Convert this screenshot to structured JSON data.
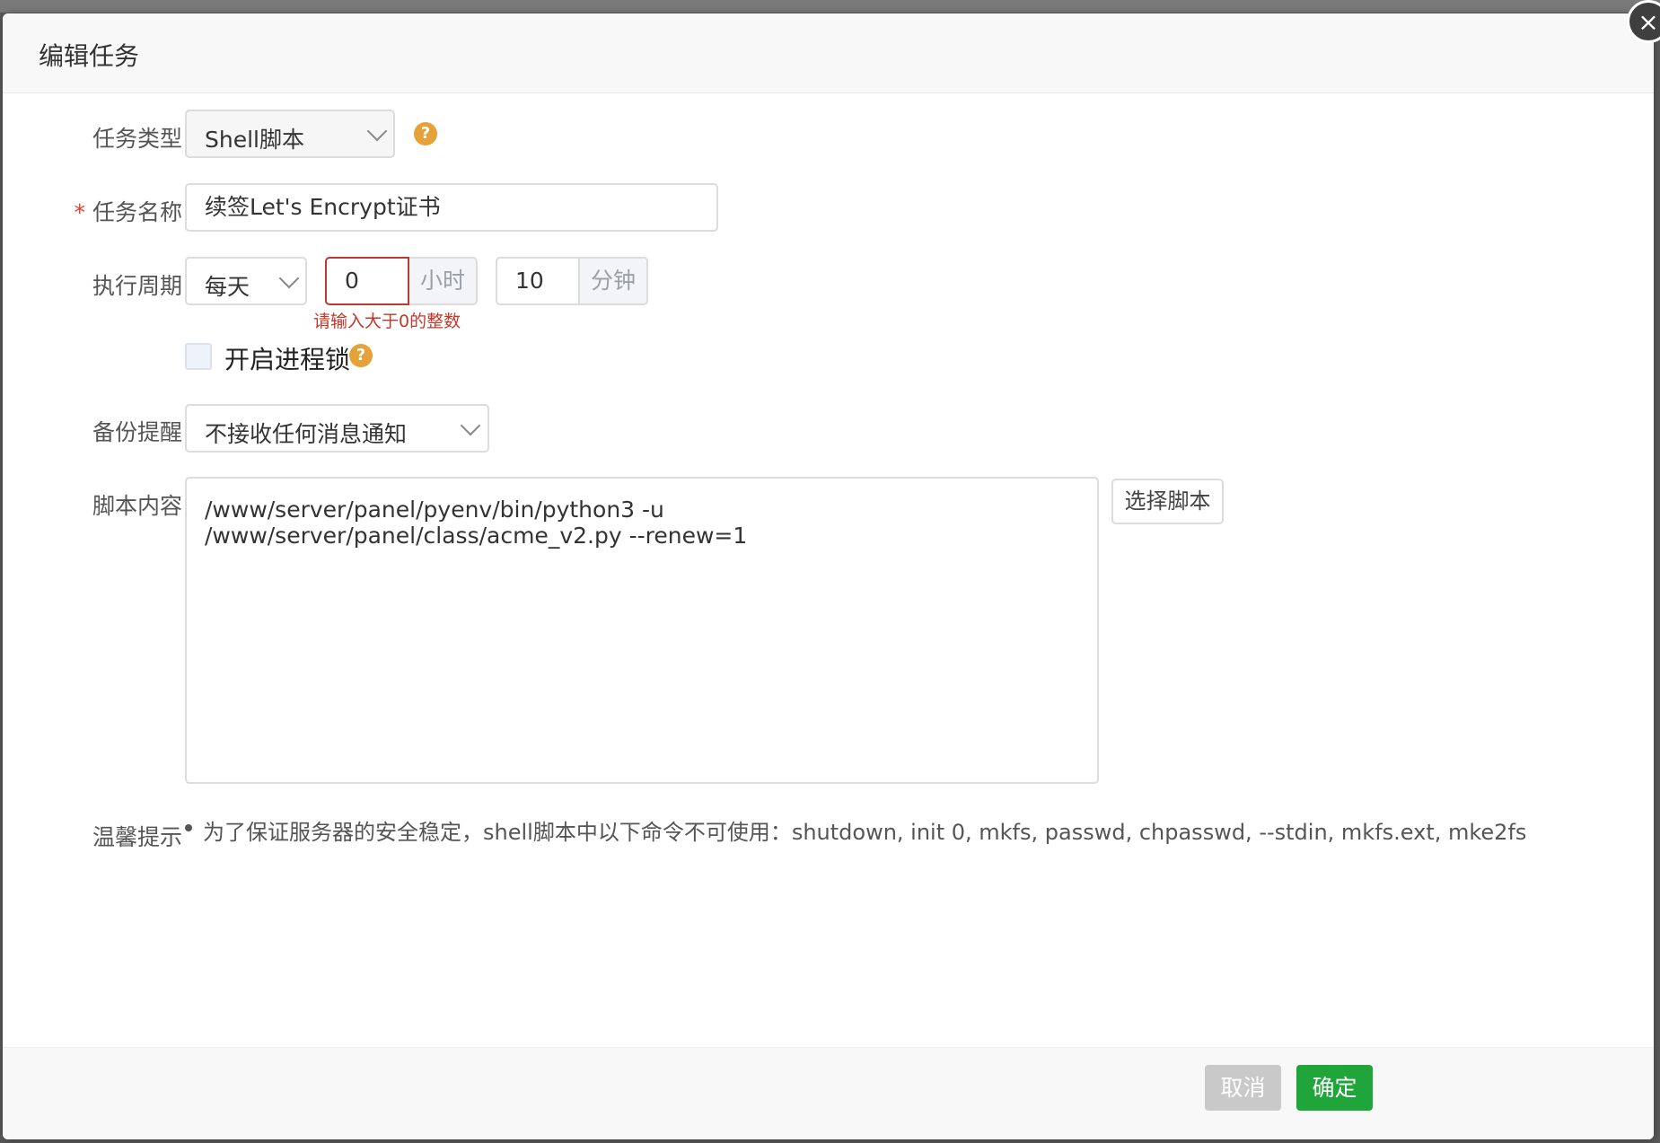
{
  "dialog": {
    "title": "编辑任务",
    "close_icon": "×"
  },
  "form": {
    "task_type": {
      "label": "任务类型",
      "value": "Shell脚本",
      "help": "?"
    },
    "task_name": {
      "required_mark": "*",
      "label": "任务名称",
      "value": "续签Let's Encrypt证书"
    },
    "schedule": {
      "label": "执行周期",
      "period": "每天",
      "hour_value": "0",
      "hour_unit": "小时",
      "minute_value": "10",
      "minute_unit": "分钟",
      "error": "请输入大于0的整数"
    },
    "process_lock": {
      "label": "开启进程锁",
      "checked": false,
      "help": "?"
    },
    "backup_notify": {
      "label": "备份提醒",
      "value": "不接收任何消息通知"
    },
    "script": {
      "label": "脚本内容",
      "value": "/www/server/panel/pyenv/bin/python3 -u /www/server/panel/class/acme_v2.py --renew=1",
      "choose_button": "选择脚本"
    },
    "tips": {
      "label": "温馨提示",
      "text": "为了保证服务器的安全稳定，shell脚本中以下命令不可使用：shutdown, init 0, mkfs, passwd, chpasswd, --stdin, mkfs.ext, mke2fs"
    }
  },
  "footer": {
    "cancel": "取消",
    "confirm": "确定"
  },
  "colors": {
    "accent_green": "#20a53a",
    "help_orange": "#e4a238",
    "error_red": "#c0392b"
  }
}
